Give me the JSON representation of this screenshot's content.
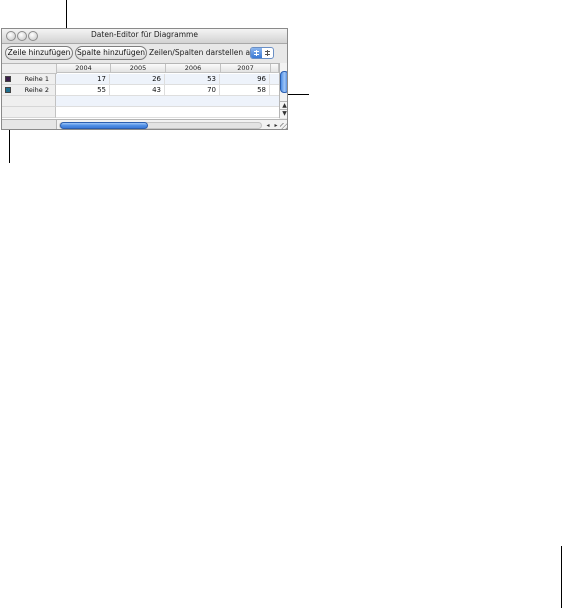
{
  "window": {
    "title": "Daten-Editor für Diagramme"
  },
  "toolbar": {
    "add_row_label": "Zeile hinzufügen",
    "add_column_label": "Spalte hinzufügen",
    "plot_as_label": "Zeilen/Spalten darstellen als:"
  },
  "table": {
    "columns": [
      "2004",
      "2005",
      "2006",
      "2007"
    ],
    "rows": [
      {
        "label": "Reihe 1",
        "color": "#3b1f4a",
        "values": [
          "17",
          "26",
          "53",
          "96"
        ]
      },
      {
        "label": "Reihe 2",
        "color": "#1f6f8f",
        "values": [
          "55",
          "43",
          "70",
          "58"
        ]
      }
    ]
  },
  "scrollbars": {
    "up_arrow": "▲",
    "down_arrow": "▼",
    "left_arrow": "◂",
    "right_arrow": "▸"
  },
  "colors": {
    "accent_blue": "#4f8fe6",
    "row_band": "#eef3fb"
  }
}
